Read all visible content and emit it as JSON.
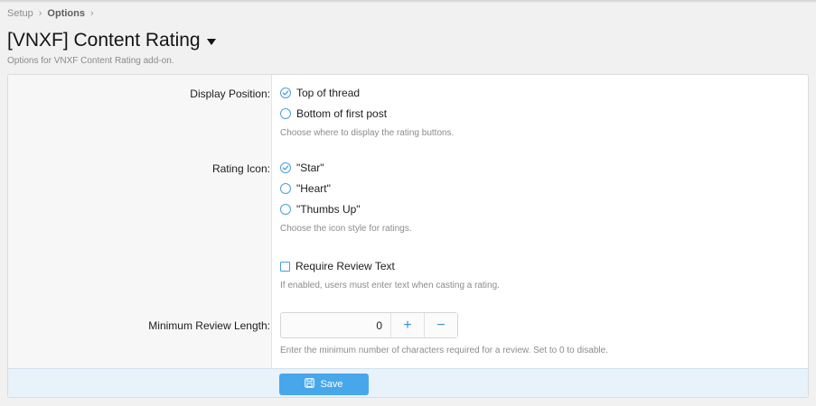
{
  "breadcrumb": {
    "items": [
      "Setup",
      "Options"
    ],
    "separator": "›"
  },
  "page": {
    "title": "[VNXF] Content Rating",
    "description": "Options for VNXF Content Rating add-on."
  },
  "options": {
    "display_position": {
      "label": "Display Position:",
      "choices": [
        "Top of thread",
        "Bottom of first post"
      ],
      "selected": "Top of thread",
      "hint": "Choose where to display the rating buttons."
    },
    "rating_icon": {
      "label": "Rating Icon:",
      "choices": [
        "\"Star\"",
        "\"Heart\"",
        "\"Thumbs Up\""
      ],
      "selected": "\"Star\"",
      "hint": "Choose the icon style for ratings."
    },
    "require_review": {
      "label": "Require Review Text",
      "checked": false,
      "hint": "If enabled, users must enter text when casting a rating."
    },
    "min_review_length": {
      "label": "Minimum Review Length:",
      "value": "0",
      "plus": "+",
      "minus": "−",
      "hint": "Enter the minimum number of characters required for a review. Set to 0 to disable."
    }
  },
  "footer": {
    "save_label": "Save"
  },
  "colors": {
    "accent": "#47a7eb",
    "footer_bg": "#e8f2fa",
    "label_bg": "#f7f7f7"
  },
  "icons": {
    "radio_selected": "check-circle-icon",
    "save": "floppy-disk-icon",
    "title_menu": "caret-down-icon"
  }
}
